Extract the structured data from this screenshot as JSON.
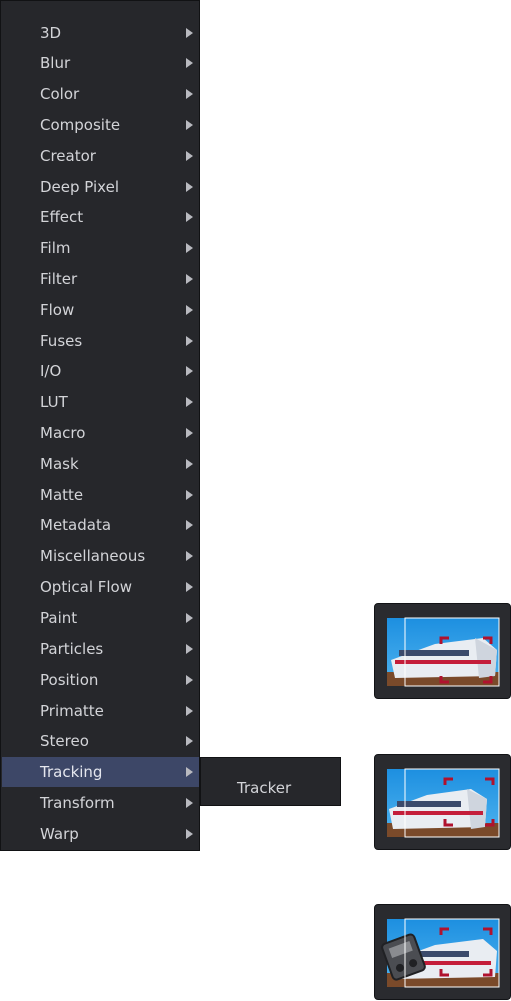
{
  "menu": {
    "items": [
      {
        "label": "3D"
      },
      {
        "label": "Blur"
      },
      {
        "label": "Color"
      },
      {
        "label": "Composite"
      },
      {
        "label": "Creator"
      },
      {
        "label": "Deep Pixel"
      },
      {
        "label": "Effect"
      },
      {
        "label": "Film"
      },
      {
        "label": "Filter"
      },
      {
        "label": "Flow"
      },
      {
        "label": "Fuses"
      },
      {
        "label": "I/O"
      },
      {
        "label": "LUT"
      },
      {
        "label": "Macro"
      },
      {
        "label": "Mask"
      },
      {
        "label": "Matte"
      },
      {
        "label": "Metadata"
      },
      {
        "label": "Miscellaneous"
      },
      {
        "label": "Optical Flow"
      },
      {
        "label": "Paint"
      },
      {
        "label": "Particles"
      },
      {
        "label": "Position"
      },
      {
        "label": "Primatte"
      },
      {
        "label": "Stereo"
      },
      {
        "label": "Tracking",
        "active": true
      },
      {
        "label": "Transform"
      },
      {
        "label": "Warp"
      }
    ],
    "arrow_icon": "chevron-right-icon"
  },
  "submenu": {
    "items": [
      {
        "label": "Tracker"
      }
    ]
  },
  "thumbnails": [
    {
      "name": "tracker-thumbnail-1",
      "icon": "train-tracking-icon"
    },
    {
      "name": "tracker-thumbnail-2",
      "icon": "train-tracking-icon"
    },
    {
      "name": "tracker-thumbnail-3",
      "icon": "train-tracking-icon"
    }
  ],
  "colors": {
    "menu_bg": "#26272b",
    "menu_text": "#d3d4d8",
    "highlight": "#3d4767",
    "thumb_frame": "#2a2b2f",
    "sky": "#1d8fe0",
    "track_marker": "#b0122e"
  }
}
